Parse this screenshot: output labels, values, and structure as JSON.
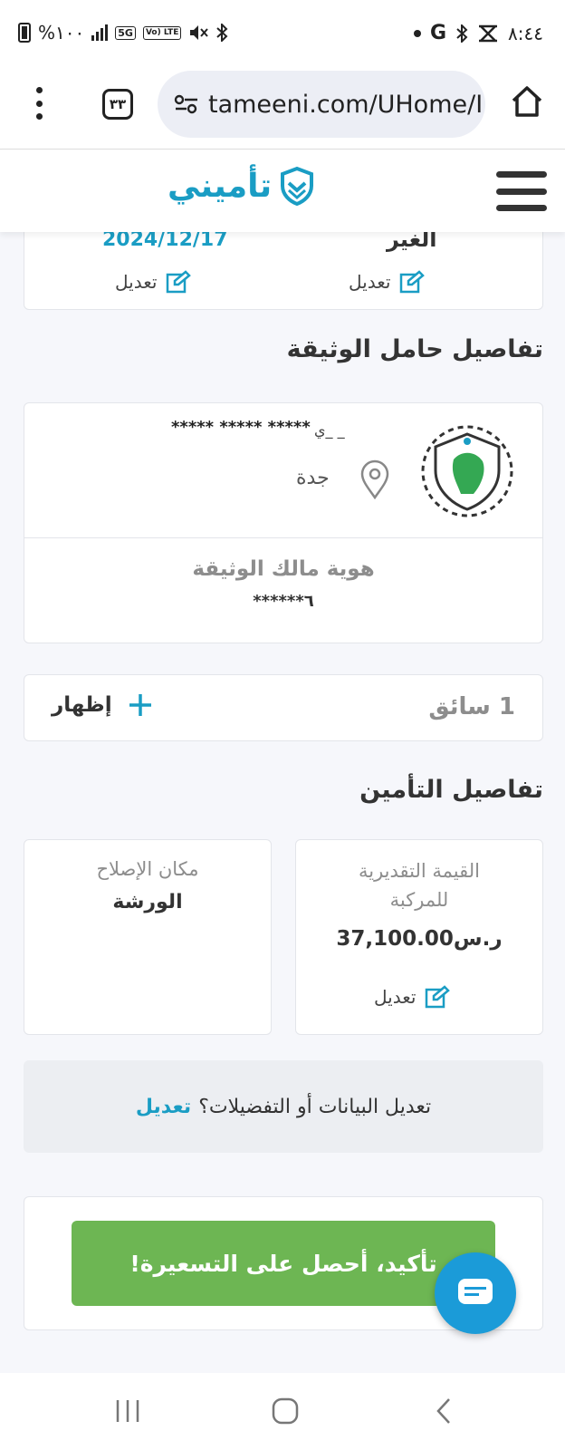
{
  "statusbar": {
    "battery_percent": "%١٠٠",
    "network_5g": "5G",
    "volte": "Vo) LTE",
    "carrier_icon": "G",
    "time": "٨:٤٤"
  },
  "browser": {
    "tab_count": "٣٣",
    "url": "tameeni.com/UHome/I"
  },
  "site": {
    "logo_text": "تأميني"
  },
  "vehicle_summary": {
    "left_value": "2024/12/17",
    "right_value": "الغير",
    "edit_label_left": "تعديل",
    "edit_label_right": "تعديل"
  },
  "policy_holder": {
    "section_title": "تفاصيل حامل الوثيقة",
    "masked_name": "***** ***** *****",
    "name_fragment": "ي_   _",
    "city": "جدة",
    "owner_id_label": "هوية مالك الوثيقة",
    "owner_id_value": "******٦"
  },
  "drivers": {
    "count_label": "1 سائق",
    "show_label": "إظهار"
  },
  "insurance": {
    "section_title": "تفاصيل التأمين",
    "vehicle_value_label": "القيمة التقديرية للمركبة",
    "vehicle_value": "37,100.00ر.س",
    "edit_label": "تعديل",
    "repair_label": "مكان الإصلاح",
    "repair_value": "الورشة"
  },
  "edit_prompt": {
    "text": "تعديل البيانات أو التفضيلات؟",
    "link": "تعديل"
  },
  "confirm_button": {
    "label": "تأكيد، أحصل على التسعيرة!"
  },
  "colors": {
    "brand_blue": "#1a9dc4",
    "confirm_green": "#6db653",
    "chat_blue": "#1b9bd8"
  }
}
